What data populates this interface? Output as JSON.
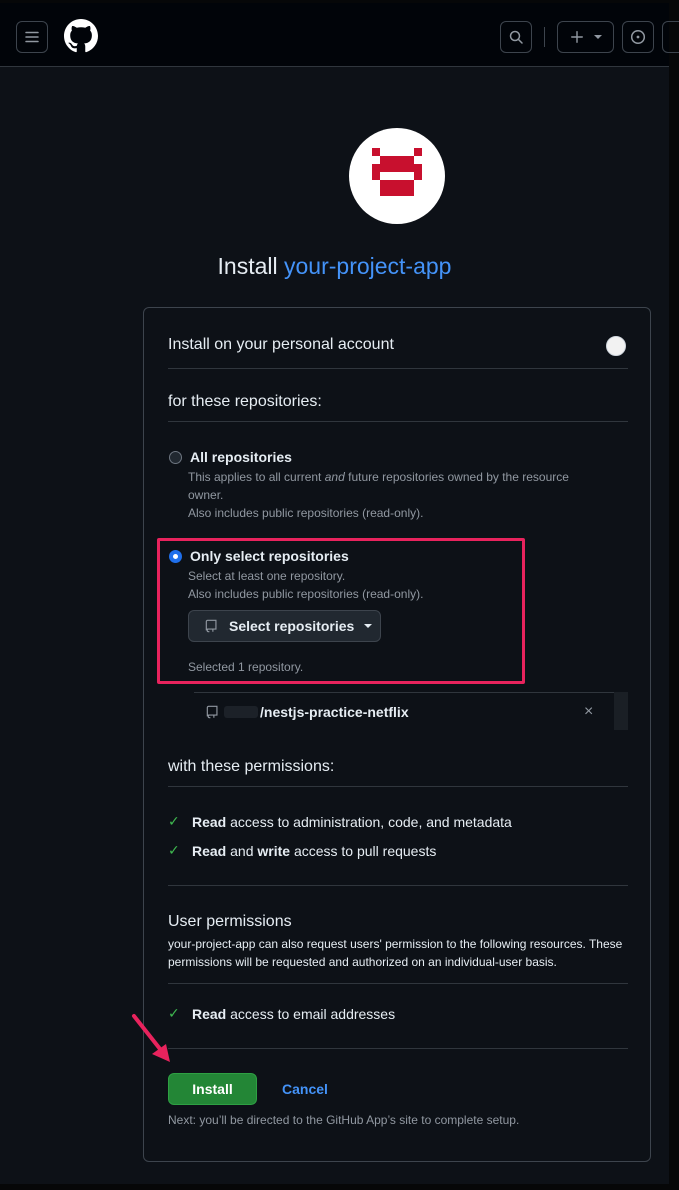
{
  "header": {
    "menu_icon": "hamburger-icon",
    "logo": "github-mark-icon",
    "search_icon": "search-icon",
    "plus_icon": "plus-icon",
    "issue_icon": "issue-opened-icon"
  },
  "app": {
    "install_prefix": "Install",
    "name": "your-project-app",
    "brand_color": "#c8102e"
  },
  "account_section": {
    "title": "Install on your personal account"
  },
  "repos_section": {
    "title": "for these repositories:",
    "all": {
      "label": "All repositories",
      "note_1": "This applies to all current",
      "note_and": "and",
      "note_2": "future repositories owned by the resource",
      "note_3": "owner.",
      "note_4": "Also includes public repositories (read-only)."
    },
    "select": {
      "label": "Only select repositories",
      "note_1": "Select at least one repository.",
      "note_2": "Also includes public repositories (read-only).",
      "button": "Select repositories",
      "selected_count": "Selected 1 repository."
    },
    "selected_repo": "/nestjs-practice-netflix",
    "remove_glyph": "×"
  },
  "permissions_section": {
    "title": "with these permissions:",
    "items": [
      {
        "bold": "Read",
        "rest": "access to administration, code, and metadata"
      },
      {
        "bold": "Read",
        "mid": "and",
        "bold2": "write",
        "rest": "access to pull requests"
      }
    ]
  },
  "user_permissions": {
    "title": "User permissions",
    "desc": "your-project-app can also request users' permission to the following resources. These permissions will be requested and authorized on an individual-user basis.",
    "items": [
      {
        "bold": "Read",
        "rest": "access to email addresses"
      }
    ]
  },
  "actions": {
    "install": "Install",
    "cancel": "Cancel",
    "next_note": "Next: you’ll be directed to the GitHub App’s site to complete setup."
  },
  "colors": {
    "accent": "#4493f8",
    "install_green": "#238636",
    "highlight": "#e8235d",
    "check": "#3fb950"
  }
}
